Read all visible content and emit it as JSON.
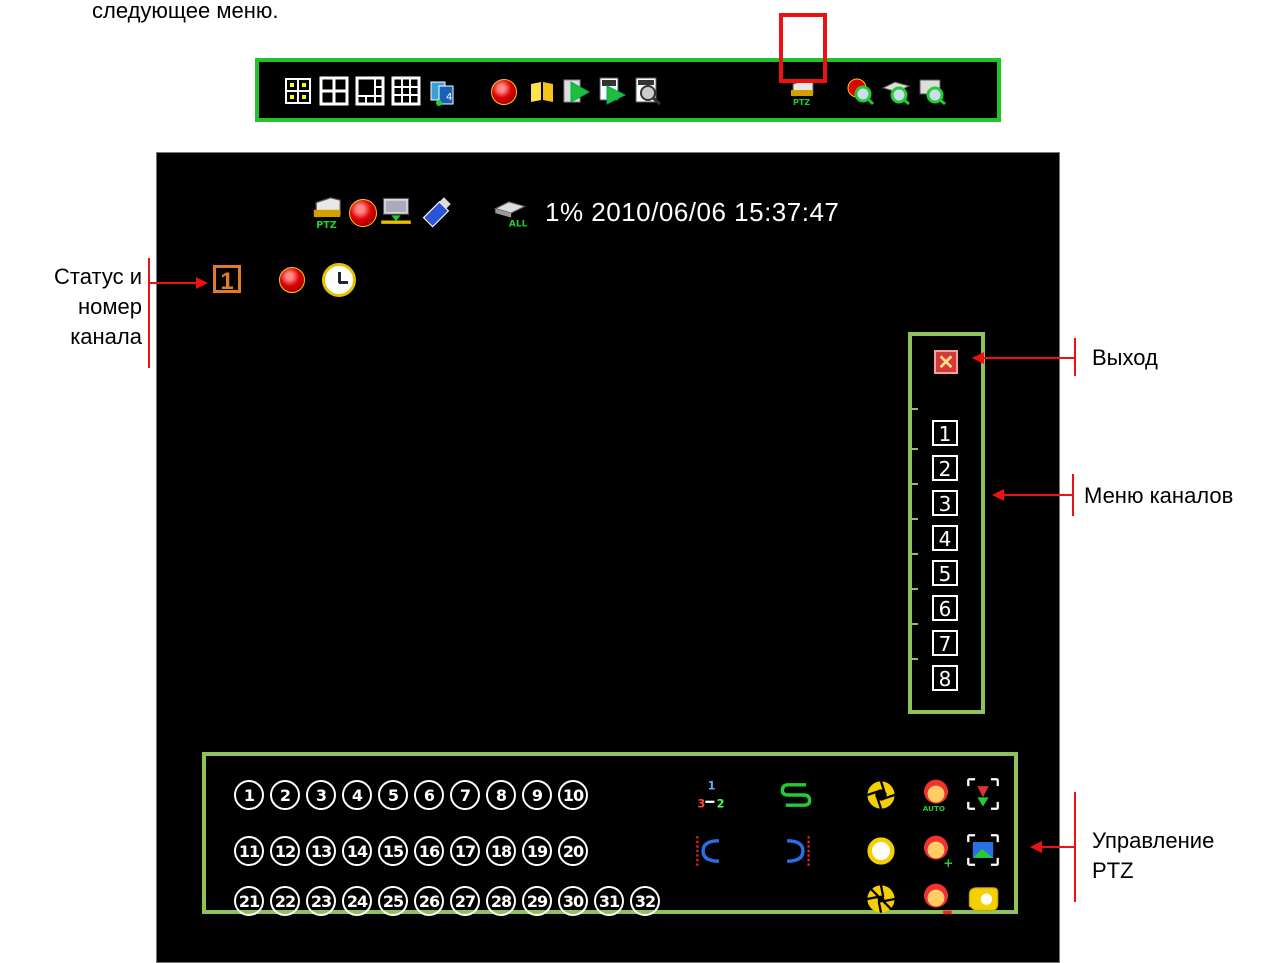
{
  "caption_top": "следующее меню.",
  "toolbar": {
    "icons": [
      "split-4-icon",
      "split-4-grid-icon",
      "split-6-icon",
      "split-9-icon",
      "sequence-icon",
      "record-icon",
      "book-icon",
      "playback-icon",
      "playback-search-icon",
      "log-search-icon",
      "ptz-icon",
      "record-search-icon",
      "hdd-search-icon",
      "system-search-icon"
    ]
  },
  "status": {
    "text": "1%  2010/06/06 15:37:47",
    "channel_number": "1"
  },
  "channel_menu": {
    "exit": "✕",
    "channels": [
      "1",
      "2",
      "3",
      "4",
      "5",
      "6",
      "7",
      "8"
    ]
  },
  "ptz": {
    "presets_row1": [
      "1",
      "2",
      "3",
      "4",
      "5",
      "6",
      "7",
      "8",
      "9",
      "10"
    ],
    "presets_row2": [
      "11",
      "12",
      "13",
      "14",
      "15",
      "16",
      "17",
      "18",
      "19",
      "20"
    ],
    "presets_row3": [
      "21",
      "22",
      "23",
      "24",
      "25",
      "26",
      "27",
      "28",
      "29",
      "30",
      "31",
      "32"
    ]
  },
  "annotations": {
    "status_channel": [
      "Статус и",
      "номер",
      "канала"
    ],
    "exit": "Выход",
    "channel_menu": "Меню каналов",
    "ptz_control": [
      "Управление",
      "PTZ"
    ]
  },
  "colors": {
    "toolbar_border": "#22c32a",
    "menu_border": "#8fc25a",
    "highlight": "#ee1111",
    "channel_status": "#e07a2d"
  }
}
